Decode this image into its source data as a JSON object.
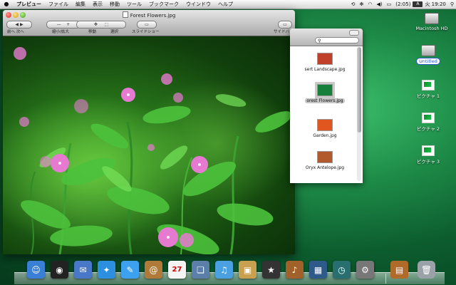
{
  "menubar": {
    "apple_icon": "",
    "app_name": "プレビュー",
    "menus": [
      "ファイル",
      "編集",
      "表示",
      "移動",
      "ツール",
      "ブックマーク",
      "ウインドウ",
      "ヘルプ"
    ],
    "status": {
      "battery": "(2:05)",
      "input_method": "A",
      "clock": "火 19:20"
    }
  },
  "preview": {
    "title": "Forest Flowers.jpg",
    "toolbar": {
      "prev_next_label": "前へ 次へ",
      "zoom_label": "縮小/拡大",
      "move_label": "移動",
      "select_label": "選択",
      "slideshow_label": "スライドショー",
      "sidebar_label": "サイドバー"
    }
  },
  "finder": {
    "items": [
      {
        "label": "sert Landscape.jpg",
        "thumb_color": "#c0402a"
      },
      {
        "label": "orest Flowers.jpg",
        "thumb_color": "#16803a",
        "selected": true
      },
      {
        "label": "Garden.jpg",
        "thumb_color": "#e0561e"
      },
      {
        "label": "Oryx Antelope.jpg",
        "thumb_color": "#b25a2c"
      }
    ]
  },
  "desktop": {
    "icons": [
      {
        "label": "Macintosh HD"
      },
      {
        "label": "Untitled"
      },
      {
        "label": "ピクチャ 1"
      },
      {
        "label": "ピクチャ 2"
      },
      {
        "label": "ピクチャ 3"
      }
    ]
  },
  "dock": {
    "apps": [
      {
        "name": "finder-icon",
        "color": "#3a7fd6",
        "glyph": "☺"
      },
      {
        "name": "dashboard-icon",
        "color": "#222",
        "glyph": "◉"
      },
      {
        "name": "mail-icon",
        "color": "#4a78c8",
        "glyph": "✉"
      },
      {
        "name": "safari-icon",
        "color": "#2c8fe0",
        "glyph": "✦"
      },
      {
        "name": "ichat-icon",
        "color": "#3da1f0",
        "glyph": "✎"
      },
      {
        "name": "address-book-icon",
        "color": "#b07a38",
        "glyph": "@"
      },
      {
        "name": "ical-icon",
        "color": "#f4f4f4",
        "glyph": "27"
      },
      {
        "name": "preview-icon",
        "color": "#5b7fa8",
        "glyph": "❏"
      },
      {
        "name": "itunes-icon",
        "color": "#4aa0e0",
        "glyph": "♫"
      },
      {
        "name": "iphoto-icon",
        "color": "#c8a050",
        "glyph": "▣"
      },
      {
        "name": "imovie-icon",
        "color": "#333",
        "glyph": "★"
      },
      {
        "name": "garageband-icon",
        "color": "#a0622a",
        "glyph": "♪"
      },
      {
        "name": "spaces-icon",
        "color": "#2e5a8a",
        "glyph": "▦"
      },
      {
        "name": "time-machine-icon",
        "color": "#2a6f6f",
        "glyph": "◷"
      },
      {
        "name": "system-preferences-icon",
        "color": "#777",
        "glyph": "⚙"
      }
    ],
    "stack": {
      "name": "pictures-stack-icon",
      "color": "#b06a2a",
      "glyph": "▤"
    },
    "trash": {
      "name": "trash-icon",
      "color": "#9aa2a8",
      "glyph": "🗑"
    }
  }
}
